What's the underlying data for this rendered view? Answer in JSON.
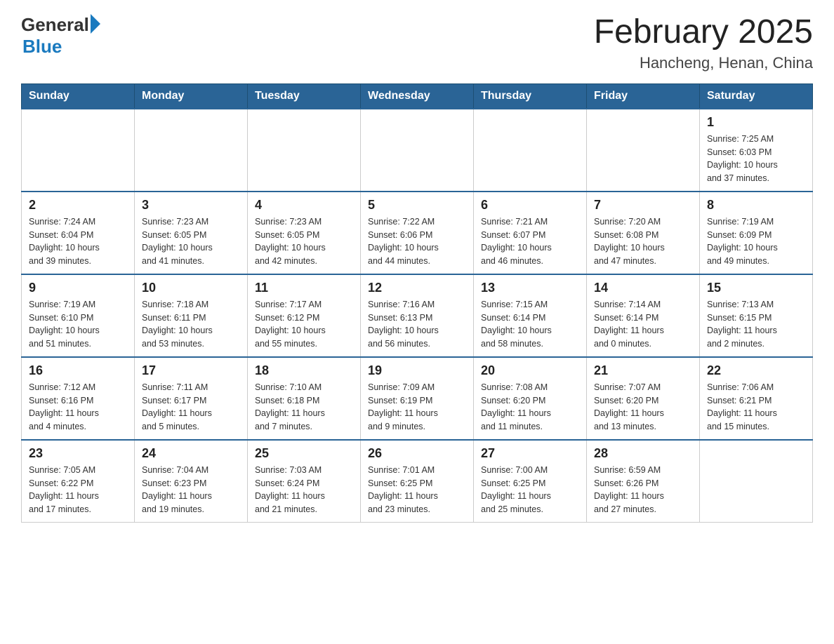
{
  "header": {
    "logo_general": "General",
    "logo_blue": "Blue",
    "month_year": "February 2025",
    "location": "Hancheng, Henan, China"
  },
  "days_of_week": [
    "Sunday",
    "Monday",
    "Tuesday",
    "Wednesday",
    "Thursday",
    "Friday",
    "Saturday"
  ],
  "weeks": [
    [
      {
        "day": "",
        "info": ""
      },
      {
        "day": "",
        "info": ""
      },
      {
        "day": "",
        "info": ""
      },
      {
        "day": "",
        "info": ""
      },
      {
        "day": "",
        "info": ""
      },
      {
        "day": "",
        "info": ""
      },
      {
        "day": "1",
        "info": "Sunrise: 7:25 AM\nSunset: 6:03 PM\nDaylight: 10 hours\nand 37 minutes."
      }
    ],
    [
      {
        "day": "2",
        "info": "Sunrise: 7:24 AM\nSunset: 6:04 PM\nDaylight: 10 hours\nand 39 minutes."
      },
      {
        "day": "3",
        "info": "Sunrise: 7:23 AM\nSunset: 6:05 PM\nDaylight: 10 hours\nand 41 minutes."
      },
      {
        "day": "4",
        "info": "Sunrise: 7:23 AM\nSunset: 6:05 PM\nDaylight: 10 hours\nand 42 minutes."
      },
      {
        "day": "5",
        "info": "Sunrise: 7:22 AM\nSunset: 6:06 PM\nDaylight: 10 hours\nand 44 minutes."
      },
      {
        "day": "6",
        "info": "Sunrise: 7:21 AM\nSunset: 6:07 PM\nDaylight: 10 hours\nand 46 minutes."
      },
      {
        "day": "7",
        "info": "Sunrise: 7:20 AM\nSunset: 6:08 PM\nDaylight: 10 hours\nand 47 minutes."
      },
      {
        "day": "8",
        "info": "Sunrise: 7:19 AM\nSunset: 6:09 PM\nDaylight: 10 hours\nand 49 minutes."
      }
    ],
    [
      {
        "day": "9",
        "info": "Sunrise: 7:19 AM\nSunset: 6:10 PM\nDaylight: 10 hours\nand 51 minutes."
      },
      {
        "day": "10",
        "info": "Sunrise: 7:18 AM\nSunset: 6:11 PM\nDaylight: 10 hours\nand 53 minutes."
      },
      {
        "day": "11",
        "info": "Sunrise: 7:17 AM\nSunset: 6:12 PM\nDaylight: 10 hours\nand 55 minutes."
      },
      {
        "day": "12",
        "info": "Sunrise: 7:16 AM\nSunset: 6:13 PM\nDaylight: 10 hours\nand 56 minutes."
      },
      {
        "day": "13",
        "info": "Sunrise: 7:15 AM\nSunset: 6:14 PM\nDaylight: 10 hours\nand 58 minutes."
      },
      {
        "day": "14",
        "info": "Sunrise: 7:14 AM\nSunset: 6:14 PM\nDaylight: 11 hours\nand 0 minutes."
      },
      {
        "day": "15",
        "info": "Sunrise: 7:13 AM\nSunset: 6:15 PM\nDaylight: 11 hours\nand 2 minutes."
      }
    ],
    [
      {
        "day": "16",
        "info": "Sunrise: 7:12 AM\nSunset: 6:16 PM\nDaylight: 11 hours\nand 4 minutes."
      },
      {
        "day": "17",
        "info": "Sunrise: 7:11 AM\nSunset: 6:17 PM\nDaylight: 11 hours\nand 5 minutes."
      },
      {
        "day": "18",
        "info": "Sunrise: 7:10 AM\nSunset: 6:18 PM\nDaylight: 11 hours\nand 7 minutes."
      },
      {
        "day": "19",
        "info": "Sunrise: 7:09 AM\nSunset: 6:19 PM\nDaylight: 11 hours\nand 9 minutes."
      },
      {
        "day": "20",
        "info": "Sunrise: 7:08 AM\nSunset: 6:20 PM\nDaylight: 11 hours\nand 11 minutes."
      },
      {
        "day": "21",
        "info": "Sunrise: 7:07 AM\nSunset: 6:20 PM\nDaylight: 11 hours\nand 13 minutes."
      },
      {
        "day": "22",
        "info": "Sunrise: 7:06 AM\nSunset: 6:21 PM\nDaylight: 11 hours\nand 15 minutes."
      }
    ],
    [
      {
        "day": "23",
        "info": "Sunrise: 7:05 AM\nSunset: 6:22 PM\nDaylight: 11 hours\nand 17 minutes."
      },
      {
        "day": "24",
        "info": "Sunrise: 7:04 AM\nSunset: 6:23 PM\nDaylight: 11 hours\nand 19 minutes."
      },
      {
        "day": "25",
        "info": "Sunrise: 7:03 AM\nSunset: 6:24 PM\nDaylight: 11 hours\nand 21 minutes."
      },
      {
        "day": "26",
        "info": "Sunrise: 7:01 AM\nSunset: 6:25 PM\nDaylight: 11 hours\nand 23 minutes."
      },
      {
        "day": "27",
        "info": "Sunrise: 7:00 AM\nSunset: 6:25 PM\nDaylight: 11 hours\nand 25 minutes."
      },
      {
        "day": "28",
        "info": "Sunrise: 6:59 AM\nSunset: 6:26 PM\nDaylight: 11 hours\nand 27 minutes."
      },
      {
        "day": "",
        "info": ""
      }
    ]
  ]
}
